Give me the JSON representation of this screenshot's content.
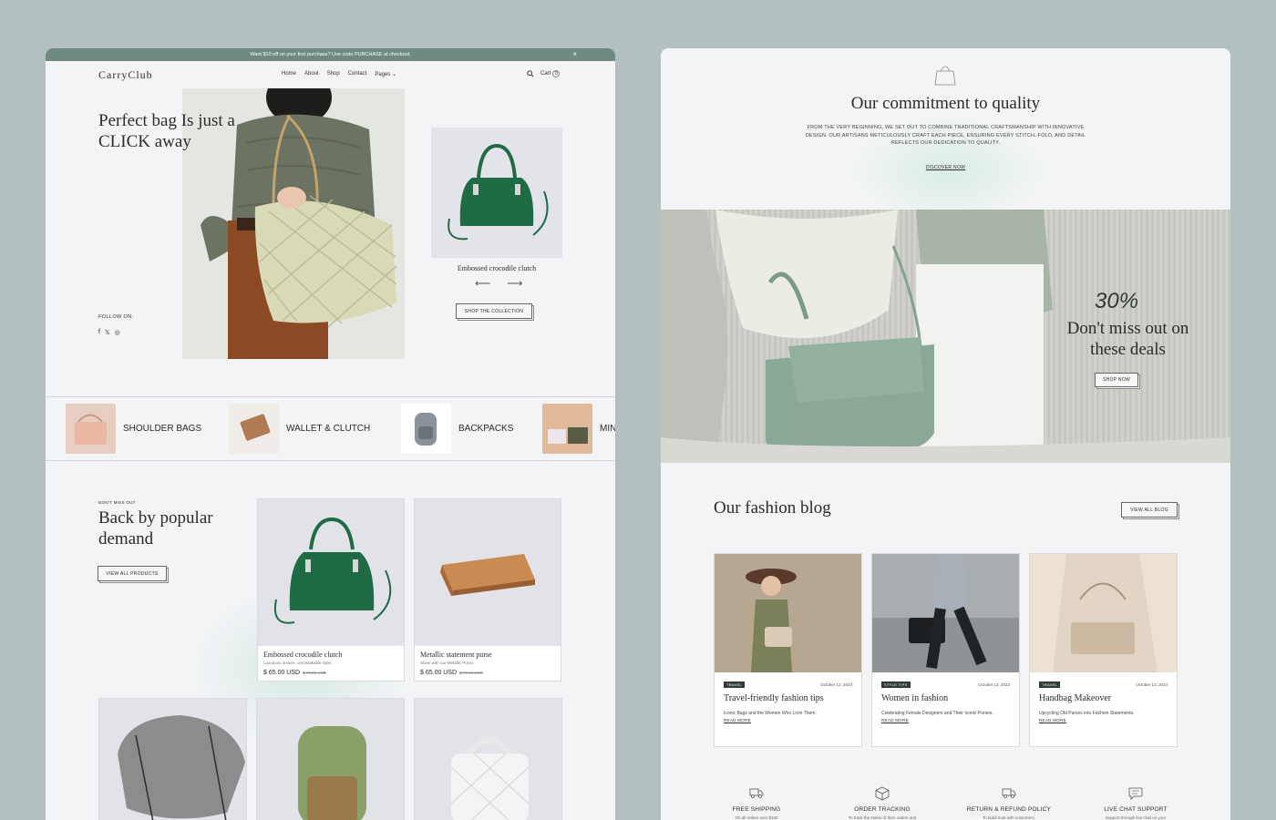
{
  "announcement": {
    "text": "Want $10 off on your first purchase? Use code PURCHASE at checkout.",
    "close": "×"
  },
  "header": {
    "logo": "CarryClub",
    "nav": [
      "Home",
      "About",
      "Shop",
      "Contact",
      "Pages"
    ],
    "cart_label": "Cart",
    "cart_count": "0"
  },
  "hero": {
    "title": "Perfect bag Is just a CLICK away",
    "follow_label": "FOLLOW ON:",
    "featured_name": "Embossed crocodile clutch",
    "prev_arrow": "⟵",
    "next_arrow": "⟶",
    "cta": "SHOP THE COLLECTION"
  },
  "categories": [
    {
      "label": "SHOULDER BAGS"
    },
    {
      "label": "WALLET & CLUTCH"
    },
    {
      "label": "BACKPACKS"
    },
    {
      "label": "MIN"
    }
  ],
  "popular": {
    "eyebrow": "DON'T MISS OUT",
    "title": "Back by popular demand",
    "cta": "VIEW ALL PRODUCTS",
    "products": [
      {
        "name": "Embossed crocodile clutch",
        "desc": "Luxurious texture, unmistakable style.",
        "price": "$ 65.00 USD",
        "old_price": "$ 70.00 USD"
      },
      {
        "name": "Metallic statement purse",
        "desc": "Shine with our Metallic Purse.",
        "price": "$ 65.00 USD",
        "old_price": "$ 70.00 USD"
      }
    ]
  },
  "quality": {
    "title": "Our commitment to quality",
    "body": "FROM THE VERY BEGINNING, WE SET OUT TO COMBINE TRADITIONAL CRAFTSMANSHIP WITH INNOVATIVE DESIGN. OUR ARTISANS METICULOUSLY CRAFT EACH PIECE, ENSURING EVERY STITCH, FOLD, AND DETAIL REFLECTS OUR DEDICATION TO QUALITY.",
    "link": "DISCOVER NOW"
  },
  "deal": {
    "percent": "30%",
    "title": "Don't miss out on these deals",
    "cta": "SHOP NOW"
  },
  "blog": {
    "title": "Our fashion blog",
    "cta": "VIEW ALL BLOG",
    "posts": [
      {
        "tag": "TRAVEL",
        "date": "October 13, 2023",
        "title": "Travel-friendly fashion tips",
        "excerpt": "Iconic Bags and the Women Who Love Them.",
        "more": "READ MORE"
      },
      {
        "tag": "STYLE TIPS",
        "date": "October 13, 2023",
        "title": "Women in fashion",
        "excerpt": "Celebrating Female Designers and Their Iconic Purses.",
        "more": "READ MORE"
      },
      {
        "tag": "TRAVEL",
        "date": "October 13, 2023",
        "title": "Handbag Makeover",
        "excerpt": "Upcycling Old Purses into Fashion Statements.",
        "more": "READ MORE"
      }
    ]
  },
  "features": [
    {
      "title": "FREE SHIPPING",
      "sub": "On all orders over $150"
    },
    {
      "title": "ORDER TRACKING",
      "sub": "To track the status of their orders and"
    },
    {
      "title": "RETURN & REFUND POLICY",
      "sub": "To build trust with customers."
    },
    {
      "title": "LIVE CHAT SUPPORT",
      "sub": "Support through live chat on your"
    }
  ],
  "colors": {
    "background": "#b3c0bf",
    "announcement_bar": "#6f8a80",
    "panel": "#f3f4f6",
    "bag_green": "#1f6b45",
    "tag_dark": "#2f3b37"
  }
}
